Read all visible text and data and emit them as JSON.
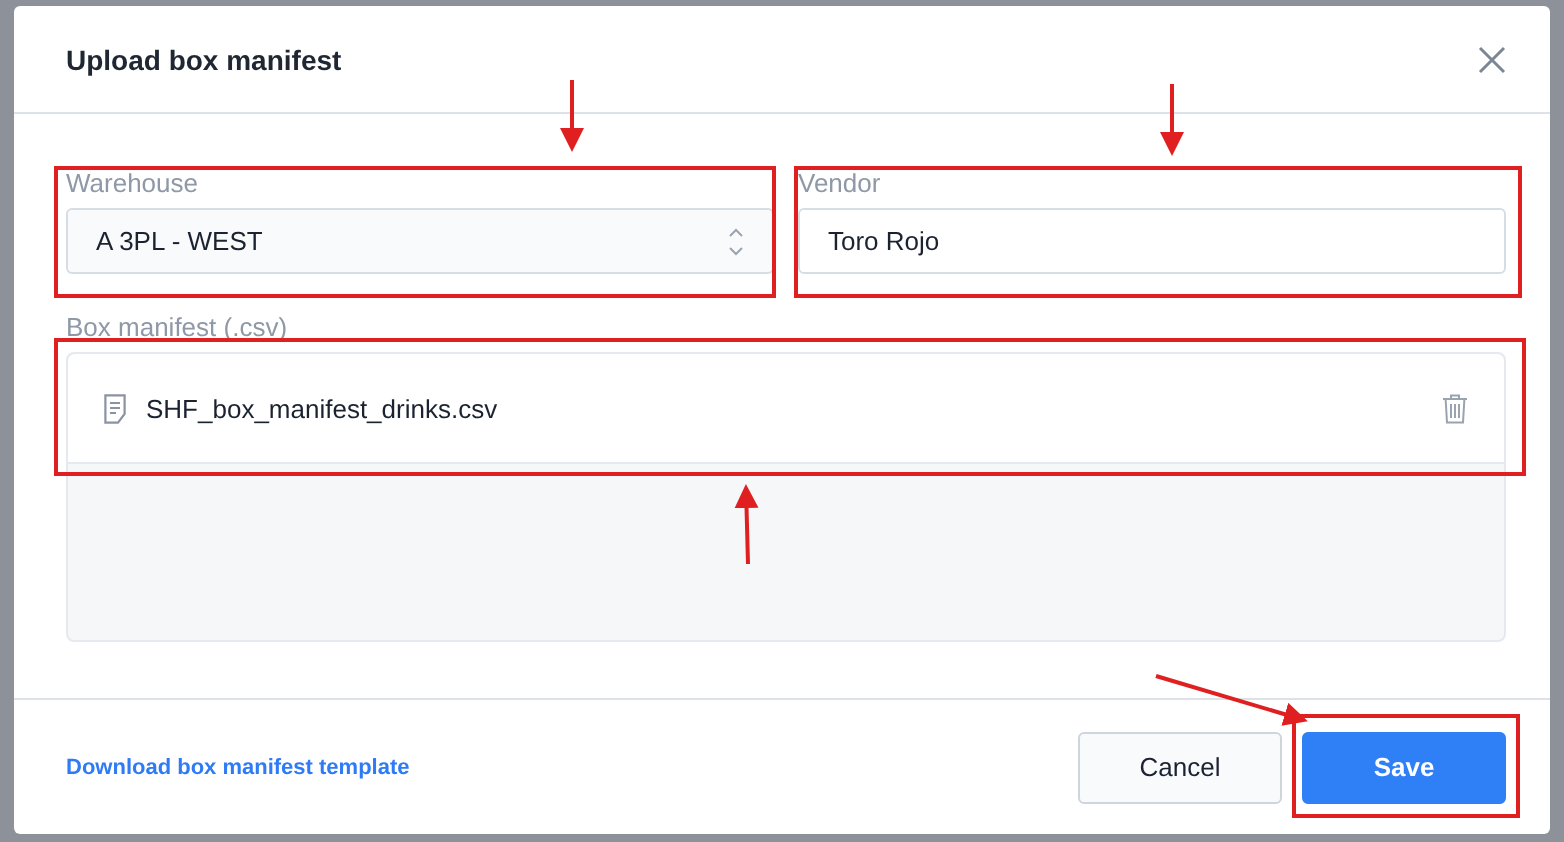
{
  "dialog": {
    "title": "Upload box manifest"
  },
  "fields": [
    {
      "kind": "select",
      "label": "Warehouse",
      "value": "A 3PL - WEST"
    },
    {
      "kind": "text",
      "label": "Vendor",
      "value": "Toro Rojo"
    }
  ],
  "manifest": {
    "label": "Box manifest (.csv)",
    "files": [
      {
        "name": "SHF_box_manifest_drinks.csv"
      }
    ]
  },
  "footer": {
    "link": "Download box manifest template",
    "buttons": [
      {
        "label": "Cancel",
        "kind": "secondary"
      },
      {
        "label": "Save",
        "kind": "primary"
      }
    ]
  }
}
